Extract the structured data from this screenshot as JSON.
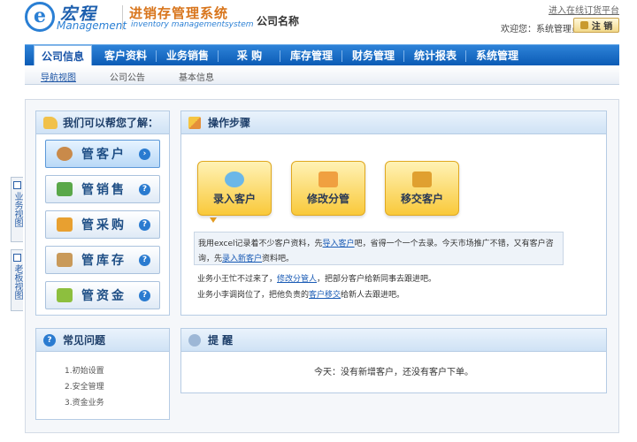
{
  "header": {
    "brand": "宏程",
    "brand_sub": "Management",
    "logo_letter": "e",
    "system_title": "进销存管理系统",
    "system_sub": "inventory managementsystem",
    "company": "公司名称",
    "enter_link": "进入在线订货平台",
    "welcome": "欢迎您：系统管理员",
    "logout": "注 销"
  },
  "nav": {
    "items": [
      {
        "label": "公司信息"
      },
      {
        "label": "客户资料"
      },
      {
        "label": "业务销售"
      },
      {
        "label": "采 购"
      },
      {
        "label": "库存管理"
      },
      {
        "label": "财务管理"
      },
      {
        "label": "统计报表"
      },
      {
        "label": "系统管理"
      }
    ],
    "active": 0
  },
  "subnav": {
    "items": [
      {
        "label": "导航视图"
      },
      {
        "label": "公司公告"
      },
      {
        "label": "基本信息"
      }
    ],
    "active": 0
  },
  "side_tabs": [
    {
      "label": "业务视图"
    },
    {
      "label": "老板视图"
    }
  ],
  "help_panel": {
    "title": "我们可以帮您了解：",
    "items": [
      {
        "label": "管客户",
        "icon": "customer-icon",
        "color": "#c98a4a"
      },
      {
        "label": "管销售",
        "icon": "sales-icon",
        "color": "#5aa84a"
      },
      {
        "label": "管采购",
        "icon": "cart-icon",
        "color": "#e8a030"
      },
      {
        "label": "管库存",
        "icon": "box-icon",
        "color": "#c99a5a"
      },
      {
        "label": "管资金",
        "icon": "money-icon",
        "color": "#8dbf3e"
      }
    ],
    "active_index": 0
  },
  "faq_panel": {
    "title": "常见问题",
    "items": [
      {
        "label": "1.初始设置"
      },
      {
        "label": "2.安全管理"
      },
      {
        "label": "3.资金业务"
      }
    ]
  },
  "steps_panel": {
    "title": "操作步骤",
    "steps": [
      {
        "label": "录入客户",
        "icon": "add-customer-icon",
        "color": "#6bb7e8"
      },
      {
        "label": "修改分管",
        "icon": "edit-icon",
        "color": "#f0a040"
      },
      {
        "label": "移交客户",
        "icon": "transfer-icon",
        "color": "#e0a030"
      }
    ],
    "help": {
      "line1_pre": "我用excel记录着不少客户资料，先",
      "line1_link": "导入客户",
      "line1_post": "吧，省得一个一个去录。今天市场推广不错，又有客户咨",
      "line2_pre": "询，先",
      "line2_link": "录入新客户",
      "line2_post": "资料吧。"
    },
    "line3_pre": "业务小王忙不过来了，",
    "line3_link": "修改分管人",
    "line3_post": "，把部分客户给新同事去跟进吧。",
    "line4_pre": "业务小李调岗位了，把他负责的",
    "line4_link": "客户移交",
    "line4_post": "给新人去跟进吧。"
  },
  "remind_panel": {
    "title": "提 醒",
    "text": "今天：没有新增客户，还没有客户下单。"
  }
}
